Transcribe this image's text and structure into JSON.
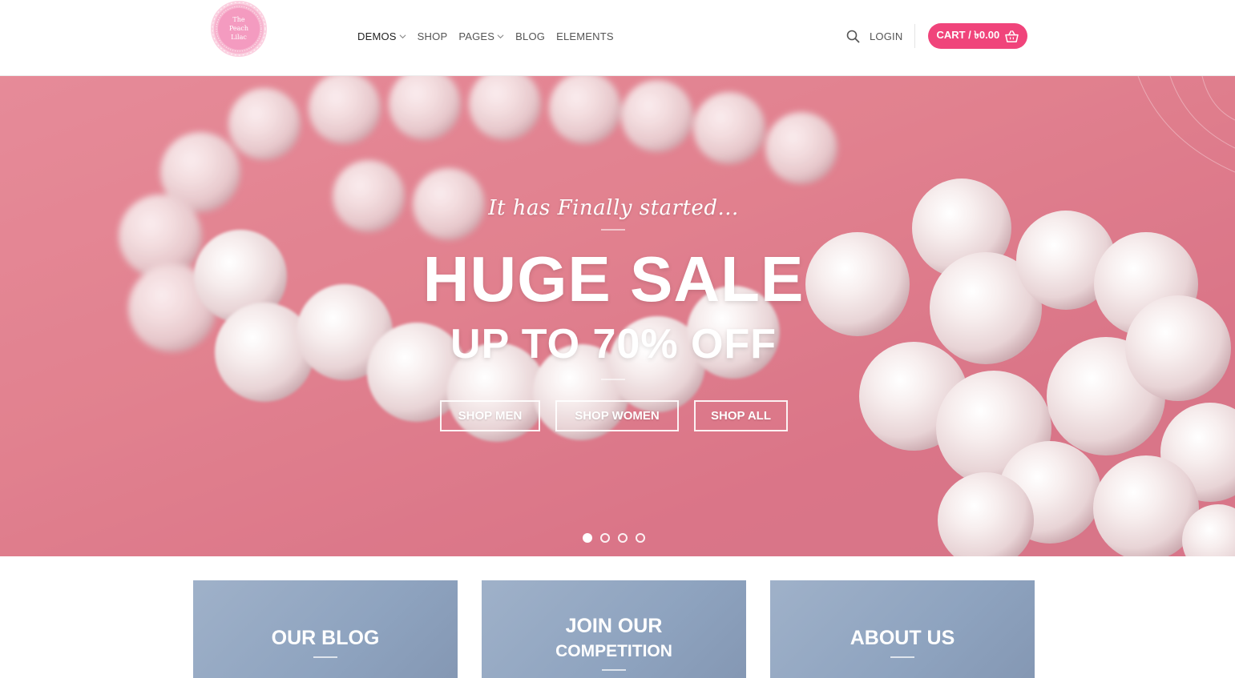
{
  "brand": {
    "logo_line1": "The",
    "logo_line2": "Peach",
    "logo_line3": "Lilac",
    "accent_color": "#f0447b"
  },
  "nav": {
    "items": [
      {
        "label": "DEMOS",
        "has_dropdown": true,
        "active": true
      },
      {
        "label": "SHOP",
        "has_dropdown": false
      },
      {
        "label": "PAGES",
        "has_dropdown": true
      },
      {
        "label": "BLOG",
        "has_dropdown": false
      },
      {
        "label": "ELEMENTS",
        "has_dropdown": false
      }
    ]
  },
  "header_right": {
    "search_icon": "search-icon",
    "login_label": "LOGIN",
    "cart_label": "CART / ৳0.00",
    "cart_icon": "basket-icon"
  },
  "hero": {
    "kicker": "It has Finally started...",
    "headline": "HUGE SALE",
    "subline": "UP TO 70% OFF",
    "buttons": [
      "SHOP MEN",
      "SHOP WOMEN",
      "SHOP ALL"
    ],
    "slide_count": 4,
    "active_slide": 1
  },
  "boxes": [
    {
      "line1": "OUR BLOG",
      "line2": ""
    },
    {
      "line1": "JOIN OUR",
      "line2": "COMPETITION"
    },
    {
      "line1": "ABOUT US",
      "line2": ""
    }
  ]
}
